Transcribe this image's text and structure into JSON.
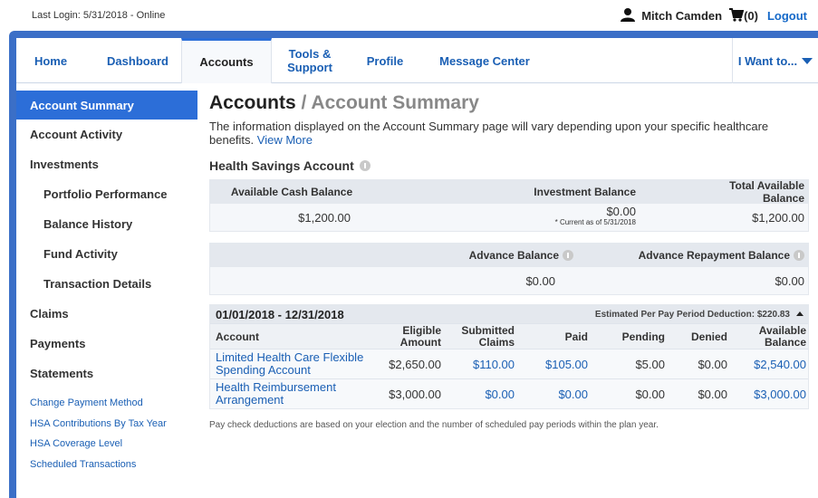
{
  "header": {
    "last_login": "Last Login: 5/31/2018 - Online",
    "user_name": "Mitch Camden",
    "cart_count": "(0)",
    "logout": "Logout"
  },
  "nav": {
    "items": [
      {
        "label": "Home"
      },
      {
        "label": "Dashboard"
      },
      {
        "label": "Accounts"
      },
      {
        "label_line1": "Tools &",
        "label_line2": "Support"
      },
      {
        "label": "Profile"
      },
      {
        "label": "Message Center"
      }
    ],
    "i_want": "I Want to..."
  },
  "sidebar": {
    "items": [
      {
        "label": "Account Summary"
      },
      {
        "label": "Account Activity"
      },
      {
        "label": "Investments"
      },
      {
        "label": "Portfolio Performance"
      },
      {
        "label": "Balance History"
      },
      {
        "label": "Fund Activity"
      },
      {
        "label": "Transaction Details"
      },
      {
        "label": "Claims"
      },
      {
        "label": "Payments"
      },
      {
        "label": "Statements"
      }
    ],
    "links": [
      "Change Payment Method",
      "HSA Contributions By Tax Year",
      "HSA Coverage Level",
      "Scheduled Transactions"
    ]
  },
  "main": {
    "title": "Accounts",
    "title_sep": " / ",
    "subtitle": "Account Summary",
    "intro": "The information displayed on the Account Summary page will vary depending upon your specific healthcare benefits.",
    "view_more": "View More",
    "hsa_title": "Health Savings Account",
    "hsa_table": {
      "headers": [
        "Available Cash Balance",
        "Investment Balance",
        "Total Available Balance"
      ],
      "values": [
        "$1,200.00",
        "$0.00",
        "$1,200.00"
      ],
      "note": "* Current as of 5/31/2018"
    },
    "advance_table": {
      "headers": [
        "Advance Balance",
        "Advance Repayment Balance"
      ],
      "values": [
        "$0.00",
        "$0.00"
      ]
    },
    "plan": {
      "period": "01/01/2018 - 12/31/2018",
      "estimate": "Estimated Per Pay Period Deduction: $220.83",
      "headers": {
        "account": "Account",
        "eligible_1": "Eligible",
        "eligible_2": "Amount",
        "submitted_1": "Submitted",
        "submitted_2": "Claims",
        "paid": "Paid",
        "pending": "Pending",
        "denied": "Denied",
        "available_1": "Available",
        "available_2": "Balance"
      },
      "rows": [
        {
          "account": "Limited Health Care Flexible Spending Account",
          "eligible": "$2,650.00",
          "submitted": "$110.00",
          "paid": "$105.00",
          "pending": "$5.00",
          "denied": "$0.00",
          "available": "$2,540.00"
        },
        {
          "account": "Health Reimbursement Arrangement",
          "eligible": "$3,000.00",
          "submitted": "$0.00",
          "paid": "$0.00",
          "pending": "$0.00",
          "denied": "$0.00",
          "available": "$3,000.00"
        }
      ]
    },
    "footnote": "Pay check deductions are based on your election and the number of scheduled pay periods within the plan year."
  }
}
